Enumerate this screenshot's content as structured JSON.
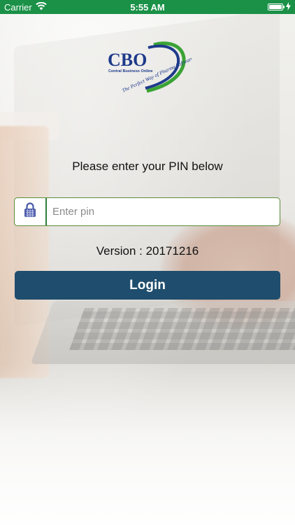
{
  "status_bar": {
    "carrier": "Carrier",
    "time": "5:55 AM",
    "wifi_icon": "wifi-icon",
    "battery_icon": "battery-icon",
    "charging_icon": "charging-icon",
    "battery_level": 1.0,
    "background_color": "#1a9147"
  },
  "logo": {
    "wordmark": "CBO",
    "subtitle": "Central Business Online",
    "tagline": "The Perfect Way of Pharma Software",
    "colors": {
      "blue": "#1e3a8a",
      "green": "#3aa335"
    }
  },
  "login": {
    "prompt": "Please enter your PIN below",
    "pin_icon": "lock-icon",
    "pin_placeholder": "Enter pin",
    "pin_value": "",
    "version": "Version : 20171216",
    "button_label": "Login",
    "button_color": "#1f4d6d",
    "field_border_color": "#5a8b3a"
  }
}
